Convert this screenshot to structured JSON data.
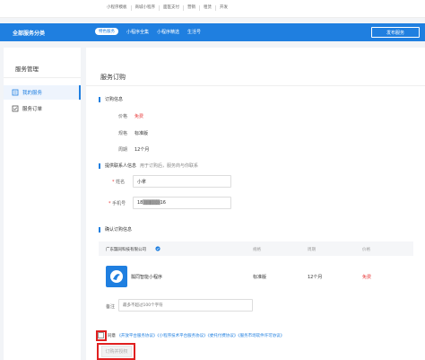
{
  "top_links": [
    "小程序模板",
    "商城小程序",
    "面医支付",
    "营销",
    "租赁",
    "开发"
  ],
  "header": {
    "category": "全部服务分类",
    "tabs": [
      {
        "label": "特色服务",
        "active": true
      },
      {
        "label": "小程序全集",
        "active": false
      },
      {
        "label": "小程序精选",
        "active": false
      },
      {
        "label": "生活号",
        "active": false
      }
    ],
    "publish_button": "发布服务"
  },
  "sidebar": {
    "title": "服务管理",
    "items": [
      {
        "label": "我的服务",
        "icon": "book-icon",
        "active": true
      },
      {
        "label": "服务订单",
        "icon": "order-check-icon",
        "active": false
      }
    ]
  },
  "page": {
    "title": "服务订购",
    "order_info": {
      "section_title": "订购信息",
      "price_label": "价格",
      "price_value": "免费",
      "spec_label": "规格",
      "spec_value": "标准版",
      "period_label": "周期",
      "period_value": "12个月"
    },
    "contact": {
      "section_title": "提供联系人信息",
      "section_hint": "用于订购后，服务商与你联系",
      "name_label": "* 姓名",
      "name_value": "小拿",
      "phone_label": "* 手机号",
      "phone_value": "18▒▒▒▒▒16"
    },
    "confirm": {
      "section_title": "确认订购信息",
      "company": "广东瓢同科技有限公司",
      "col_spec": "规格",
      "col_period": "周期",
      "col_price": "价格",
      "product_name": "瓢同智能小程序",
      "spec": "标准版",
      "period": "12个月",
      "price": "免费",
      "remark_label": "备注",
      "remark_placeholder": "最多不超过100个字符"
    },
    "agreement": {
      "prefix": "同意",
      "links": "《开放平台服务协议》《小程序技术平台服务协议》《委托付费协议》《服务市场软件许可协议》"
    },
    "order_button": "订购并授权"
  }
}
